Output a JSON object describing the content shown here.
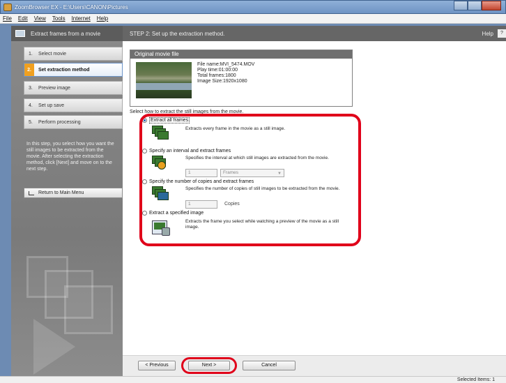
{
  "window": {
    "title": "ZoomBrowser EX - E:\\Users\\CANON\\Pictures"
  },
  "menu": [
    "File",
    "Edit",
    "View",
    "Tools",
    "Internet",
    "Help"
  ],
  "left_panel": {
    "header": "Extract frames from a movie",
    "steps": [
      {
        "num": "1.",
        "label": "Select movie"
      },
      {
        "num": "2.",
        "label": "Set extraction method"
      },
      {
        "num": "3.",
        "label": "Preview image"
      },
      {
        "num": "4.",
        "label": "Set up save"
      },
      {
        "num": "5.",
        "label": "Perform processing"
      }
    ],
    "description": "In this step, you select how you want the still images to be extracted from the movie. After selecting the extraction method, click [Next] and move on to the next step.",
    "return_button": "Return to Main Menu"
  },
  "main": {
    "header": "STEP 2: Set up the extraction method.",
    "help_label": "Help",
    "help_button": "?",
    "movie_box_title": "Original movie file",
    "movie_info": {
      "file_name": "File name:MVI_5474.MOV",
      "play_time": "Play time:01:00:00",
      "total_frames": "Total frames:1800",
      "image_size": "Image Size:1920x1080"
    },
    "select_label": "Select how to extract the still images from the movie.",
    "options": [
      {
        "label": "Extract all frames",
        "desc": "Extracts every frame in the movie as a still image."
      },
      {
        "label": "Specify an interval and extract frames",
        "desc": "Specifies the interval at which still images are extracted from the movie.",
        "input_value": "1",
        "select_value": "Frames"
      },
      {
        "label": "Specify the number of copies and extract frames",
        "desc": "Specifies the number of copies of still images to be extracted from the movie.",
        "input_value": "1",
        "unit": "Copies"
      },
      {
        "label": "Extract a specified image",
        "desc": "Extracts the frame you select while watching a preview of the movie as a still image."
      }
    ],
    "selected_option": 0
  },
  "buttons": {
    "previous": "< Previous",
    "next": "Next >",
    "cancel": "Cancel"
  },
  "status": {
    "selected_items": "Selected Items: 1"
  },
  "colors": {
    "highlight": "#e0001a",
    "active_step": "#f0a020"
  }
}
